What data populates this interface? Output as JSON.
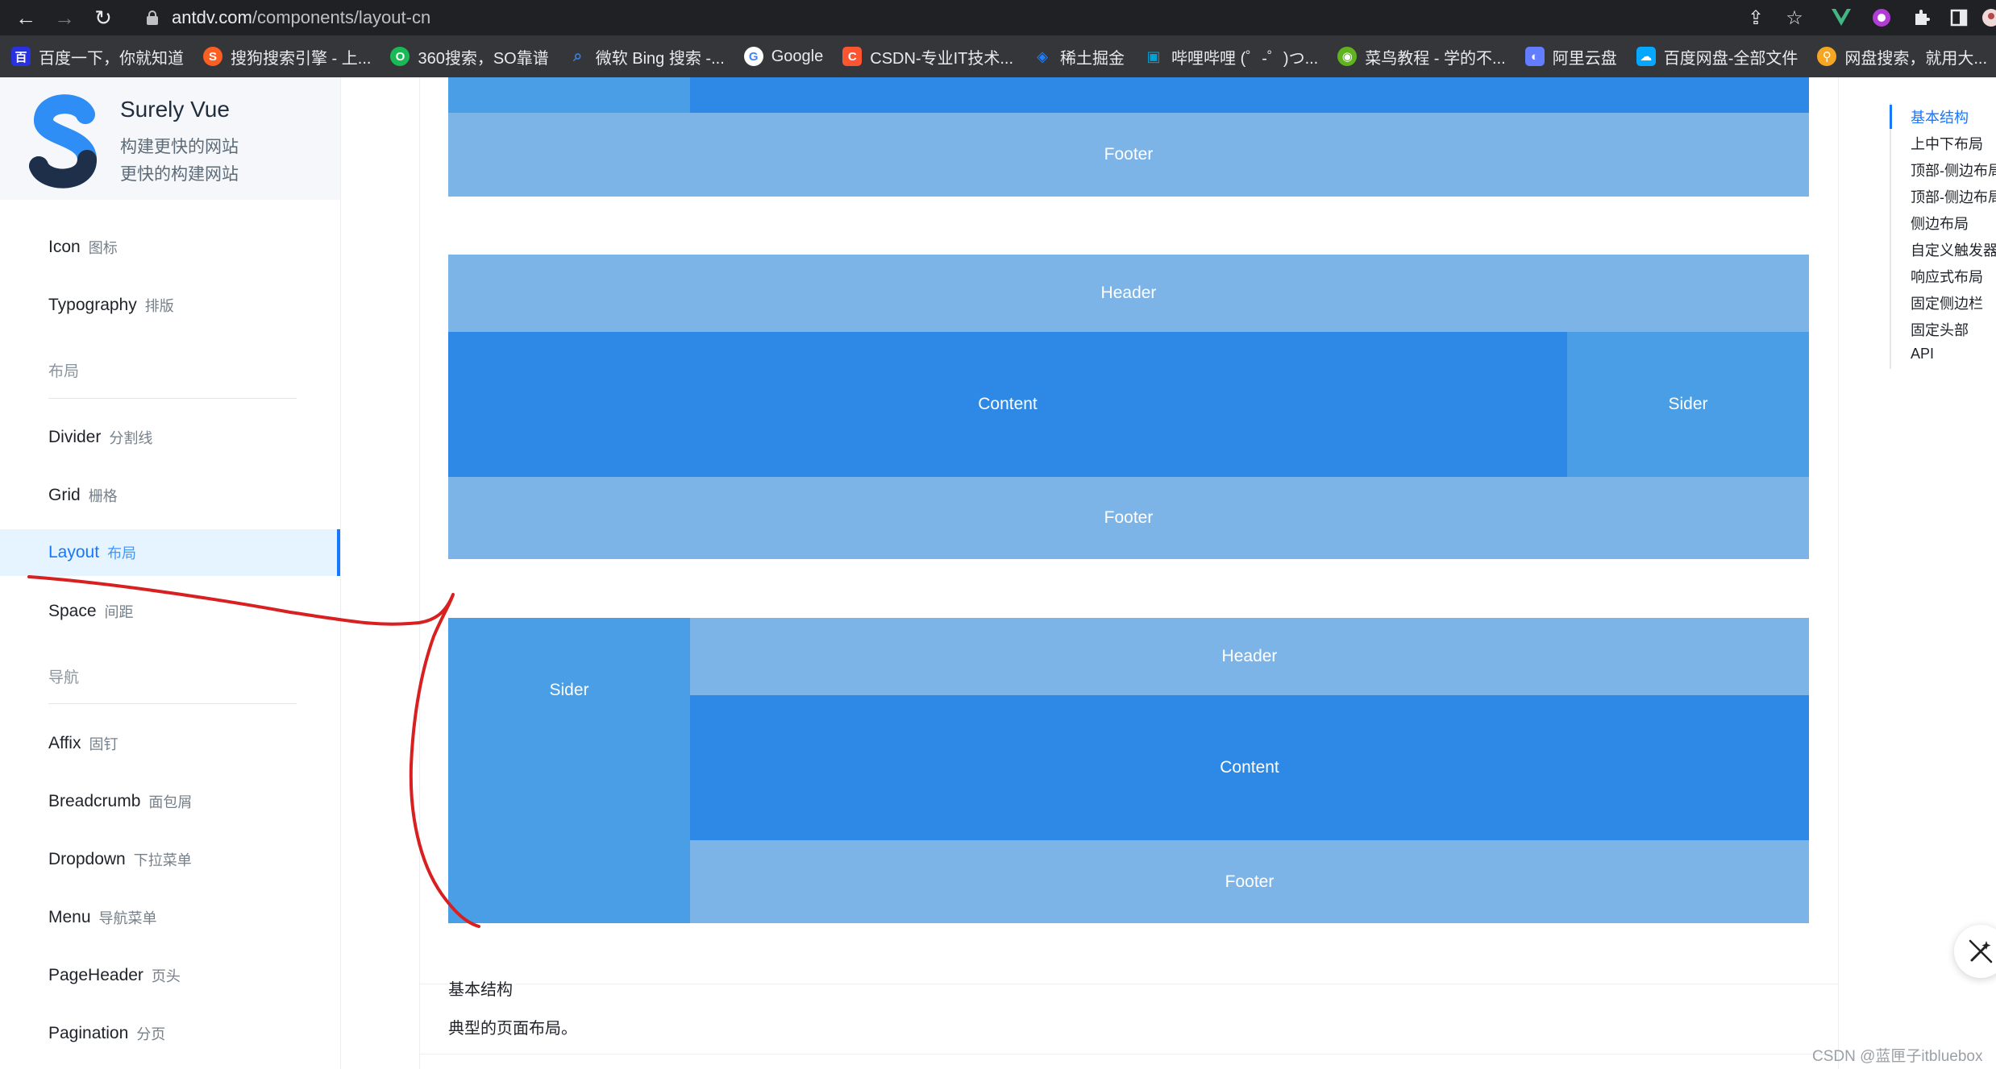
{
  "browser": {
    "url_host": "antdv.com",
    "url_path": "/components/layout-cn",
    "bookmarks": [
      {
        "label": "百度一下，你就知道",
        "icon": "baidu-icon",
        "color": "#2932e1"
      },
      {
        "label": "搜狗搜索引擎 - 上...",
        "icon": "sogou-icon",
        "color": "#fb6022"
      },
      {
        "label": "360搜索，SO靠谱",
        "icon": "360-icon",
        "color": "#19b955"
      },
      {
        "label": "微软 Bing 搜索 -...",
        "icon": "search-icon",
        "color": "#3a7bd5"
      },
      {
        "label": "Google",
        "icon": "google-icon",
        "color": "#4285f4"
      },
      {
        "label": "CSDN-专业IT技术...",
        "icon": "csdn-icon",
        "color": "#fc5531"
      },
      {
        "label": "稀土掘金",
        "icon": "juejin-icon",
        "color": "#1e80ff"
      },
      {
        "label": "哔哩哔哩 (゜-゜)つ...",
        "icon": "bilibili-icon",
        "color": "#00a1d6"
      },
      {
        "label": "菜鸟教程 - 学的不...",
        "icon": "runoob-icon",
        "color": "#5fb41e"
      },
      {
        "label": "阿里云盘",
        "icon": "aliyun-drive-icon",
        "color": "#637dff"
      },
      {
        "label": "百度网盘-全部文件",
        "icon": "baidu-pan-icon",
        "color": "#06a7ff"
      },
      {
        "label": "网盘搜索，就用大...",
        "icon": "pan-search-icon",
        "color": "#f5a623"
      }
    ],
    "bookmarks_more": "»"
  },
  "sidebar": {
    "brand_title": "Surely Vue",
    "brand_sub1": "构建更快的网站",
    "brand_sub2": "更快的构建网站",
    "items": [
      {
        "en": "Icon",
        "cn": "图标"
      },
      {
        "en": "Typography",
        "cn": "排版"
      },
      {
        "en": "Divider",
        "cn": "分割线"
      },
      {
        "en": "Grid",
        "cn": "栅格"
      },
      {
        "en": "Layout",
        "cn": "布局"
      },
      {
        "en": "Space",
        "cn": "间距"
      },
      {
        "en": "Affix",
        "cn": "固钉"
      },
      {
        "en": "Breadcrumb",
        "cn": "面包屑"
      },
      {
        "en": "Dropdown",
        "cn": "下拉菜单"
      },
      {
        "en": "Menu",
        "cn": "导航菜单"
      },
      {
        "en": "PageHeader",
        "cn": "页头"
      },
      {
        "en": "Pagination",
        "cn": "分页"
      }
    ],
    "groups": {
      "layout": "布局",
      "nav": "导航"
    }
  },
  "demo": {
    "footer": "Footer",
    "header": "Header",
    "content": "Content",
    "sider": "Sider"
  },
  "section": {
    "title": "基本结构",
    "desc": "典型的页面布局。"
  },
  "anchor": {
    "items": [
      "基本结构",
      "上中下布局",
      "顶部-侧边布局",
      "顶部-侧边布局",
      "侧边布局",
      "自定义触发器",
      "响应式布局",
      "固定侧边栏",
      "固定头部",
      "API"
    ]
  },
  "watermark": "CSDN @蓝匣子itbluebox",
  "colors": {
    "light_block": "#7db4e7",
    "dark_block": "#2d89e5",
    "sider_block": "#4a9ee6",
    "accent": "#1677ff",
    "annotation": "#d92020"
  }
}
